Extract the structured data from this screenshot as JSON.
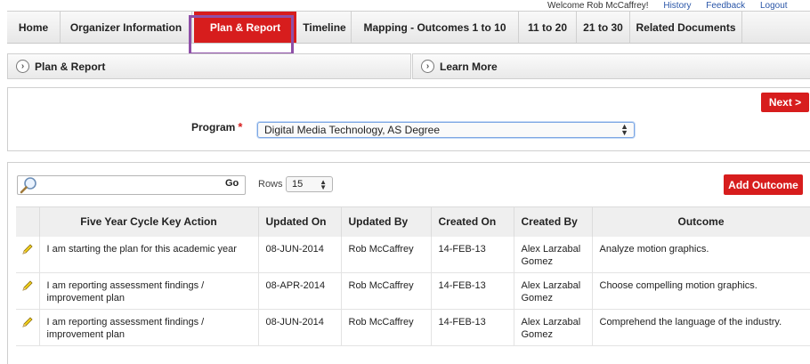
{
  "userbar": {
    "welcome": "Welcome Rob McCaffrey!",
    "links": [
      "History",
      "Feedback",
      "Logout"
    ]
  },
  "nav": {
    "tabs": [
      {
        "label": "Home",
        "active": false
      },
      {
        "label": "Organizer Information",
        "active": false
      },
      {
        "label": "Plan & Report",
        "active": true
      },
      {
        "label": "Timeline",
        "active": false
      },
      {
        "label": "Mapping - Outcomes 1 to 10",
        "active": false
      },
      {
        "label": "11 to 20",
        "active": false
      },
      {
        "label": "21 to 30",
        "active": false
      },
      {
        "label": "Related Documents",
        "active": false
      }
    ]
  },
  "regions": {
    "left": "Plan & Report",
    "right": "Learn More"
  },
  "form": {
    "next_label": "Next >",
    "program_label": "Program",
    "required_mark": "*",
    "program_value": "Digital Media Technology, AS Degree"
  },
  "report": {
    "search_placeholder": "",
    "go_label": "Go",
    "rows_label": "Rows",
    "rows_value": "15",
    "add_label": "Add Outcome",
    "columns": [
      "",
      "Five Year Cycle Key Action",
      "Updated On",
      "Updated By",
      "Created On",
      "Created By",
      "Outcome"
    ],
    "rows": [
      {
        "action": "I am starting the plan for this academic year",
        "updated_on": "08-JUN-2014",
        "updated_by": "Rob McCaffrey",
        "created_on": "14-FEB-13",
        "created_by": "Alex Larzabal Gomez",
        "outcome": "Analyze motion graphics."
      },
      {
        "action": "I am reporting assessment findings / improvement plan",
        "updated_on": "08-APR-2014",
        "updated_by": "Rob McCaffrey",
        "created_on": "14-FEB-13",
        "created_by": "Alex Larzabal Gomez",
        "outcome": "Choose compelling motion graphics."
      },
      {
        "action": "I am reporting assessment findings / improvement plan",
        "updated_on": "08-JUN-2014",
        "updated_by": "Rob McCaffrey",
        "created_on": "14-FEB-13",
        "created_by": "Alex Larzabal Gomez",
        "outcome": "Comprehend the language of the industry."
      }
    ]
  },
  "colors": {
    "accent_red": "#d71d1d",
    "highlight_purple": "#8e4fa8",
    "link_blue": "#2a56a8"
  },
  "icons": {
    "search": "magnifier-icon",
    "edit": "pencil-icon",
    "expand": "chevron-right-circle-icon"
  }
}
